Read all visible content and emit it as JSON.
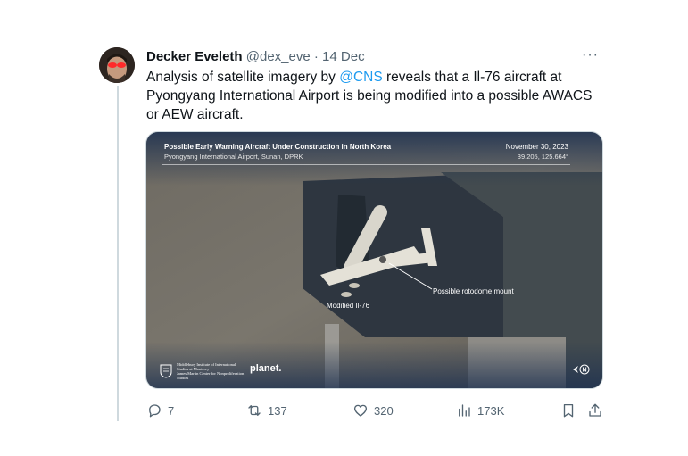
{
  "tweet": {
    "author_name": "Decker Eveleth",
    "handle": "@dex_eve",
    "separator": "·",
    "date": "14 Dec",
    "more_label": "···",
    "text_before": "Analysis of satellite imagery by ",
    "mention": "@CNS",
    "text_after": " reveals that a Il-76 aircraft at Pyongyang International Airport is being modified into a possible AWACS or AEW aircraft."
  },
  "media": {
    "title": "Possible Early Warning Aircraft Under Construction in North Korea",
    "subtitle": "Pyongyang International Airport, Sunan, DPRK",
    "date": "November 30, 2023",
    "coords": "39.205, 125.664°",
    "annotation_rotodome": "Possible rotodome mount",
    "annotation_aircraft": "Modified Il-76",
    "logo_middlebury": "Middlebury Institute of International Studies at Monterey",
    "logo_middlebury_tagline": "James Martin Center for Nonproliferation Studies",
    "logo_planet": "planet.",
    "north_label": "N"
  },
  "actions": {
    "replies": "7",
    "reposts": "137",
    "likes": "320",
    "views": "173K"
  },
  "colors": {
    "accent": "#1d9bf0",
    "muted": "#536471",
    "text": "#0f1419"
  },
  "icons": [
    "more-icon",
    "reply-icon",
    "repost-icon",
    "like-icon",
    "views-icon",
    "bookmark-icon",
    "share-icon",
    "north-arrow-icon"
  ]
}
